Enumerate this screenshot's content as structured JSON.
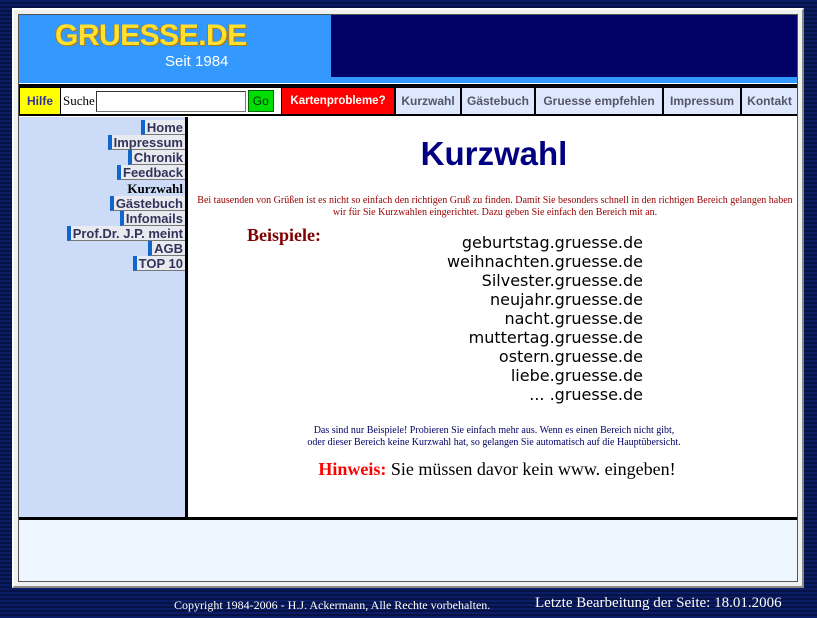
{
  "header": {
    "logo_title": "GRUESSE.DE",
    "logo_subtitle": "Seit 1984"
  },
  "nav": {
    "help": "Hilfe",
    "search_label": "Suche",
    "search_value": "",
    "go": "Go",
    "kartenprobleme": "Kartenprobleme?",
    "links": [
      "Kurzwahl",
      "Gästebuch",
      "Gruesse empfehlen",
      "Impressum",
      "Kontakt"
    ]
  },
  "sidebar": {
    "items": [
      "Home",
      "Impressum",
      "Chronik",
      "Feedback",
      "Kurzwahl",
      "Gästebuch",
      "Infomails",
      "Prof.Dr. J.P. meint",
      "AGB",
      "TOP 10"
    ],
    "active": "Kurzwahl"
  },
  "content": {
    "title": "Kurzwahl",
    "intro_line1": "Bei tausenden von Grüßen ist es nicht so einfach den richtigen Gruß zu finden. Damit Sie besonders schnell in den richtigen Bereich gelangen haben",
    "intro_line2": "wir für Sie Kurzwahlen eingerichtet. Dazu geben Sie einfach den Bereich mit an.",
    "examples_label": "Beispiele:",
    "examples": [
      "geburtstag.gruesse.de",
      "weihnachten.gruesse.de",
      "Silvester.gruesse.de",
      "neujahr.gruesse.de",
      "nacht.gruesse.de",
      "muttertag.gruesse.de",
      "ostern.gruesse.de",
      "liebe.gruesse.de",
      "... .gruesse.de"
    ],
    "note_line1": "Das sind nur Beispiele! Probieren Sie einfach mehr aus. Wenn es einen Bereich nicht gibt,",
    "note_line2": "oder dieser Bereich keine Kurzwahl hat, so gelangen Sie automatisch auf die Hauptübersicht.",
    "hint_label": "Hinweis:",
    "hint_text": "Sie müssen davor kein www. eingeben!"
  },
  "footer": {
    "copyright": "Copyright 1984-2006 - H.J. Ackermann, Alle Rechte vorbehalten.",
    "last_modified": "Letzte Bearbeitung der Seite: 18.01.2006"
  },
  "colors": {
    "header_blue": "#3399ff",
    "banner_navy": "#000066",
    "logo_yellow": "#ffe033",
    "title_navy": "#000080",
    "hint_red": "#ff0000",
    "sidebar_bg": "#ccdcf8"
  }
}
